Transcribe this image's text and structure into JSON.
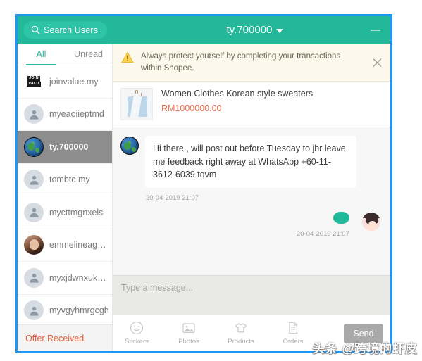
{
  "window": {
    "title": "ty.700000",
    "minimize_label": "minimize",
    "border_color": "#2196f3",
    "header_color": "#24b89a"
  },
  "search": {
    "label": "Search Users",
    "icon": "search-icon"
  },
  "sidebar": {
    "tabs": [
      {
        "label": "All",
        "active": true
      },
      {
        "label": "Unread",
        "active": false
      }
    ],
    "conversations": [
      {
        "name": "joinvalue.my",
        "avatar": "brand",
        "brand_line1": "JOIN",
        "brand_line2": "VALU",
        "selected": false
      },
      {
        "name": "myeaoiieptmd",
        "avatar": "person",
        "selected": false
      },
      {
        "name": "ty.700000",
        "avatar": "globe",
        "selected": true
      },
      {
        "name": "tombtc.my",
        "avatar": "person",
        "selected": false
      },
      {
        "name": "mycttmgnxels",
        "avatar": "person",
        "selected": false
      },
      {
        "name": "emmelineag…",
        "avatar": "photo-f",
        "selected": false
      },
      {
        "name": "myxjdwnxuk…",
        "avatar": "person",
        "selected": false
      },
      {
        "name": "myvgyhmrgcgh",
        "avatar": "person",
        "selected": false
      }
    ],
    "offer_status": "Offer Received",
    "offer_color": "#e8603c"
  },
  "notice": {
    "text": "Always protect yourself by completing your transactions within Shopee.",
    "icon": "warning-icon",
    "close_icon": "close-icon",
    "background": "#fdf8ec"
  },
  "product": {
    "title": "Women Clothes Korean style sweaters",
    "price": "RM1000000.00",
    "price_color": "#ef6b4b",
    "thumbnail": "blue-cardigan-photo"
  },
  "messages": [
    {
      "direction": "in",
      "avatar": "globe",
      "text": "Hi there , will post out before Tuesday to jhr leave me feedback right away at WhatsApp +60-11-3612-6039 tqvm",
      "time": "20-04-2019 21:07"
    },
    {
      "direction": "out",
      "avatar": "photo-anime",
      "text": "",
      "time": "20-04-2019 21:07"
    }
  ],
  "composer": {
    "placeholder": "Type a message..."
  },
  "toolbar": {
    "tools": [
      {
        "label": "Stickers",
        "icon": "smiley-icon"
      },
      {
        "label": "Photos",
        "icon": "image-icon"
      },
      {
        "label": "Products",
        "icon": "shirt-icon"
      },
      {
        "label": "Orders",
        "icon": "document-icon"
      }
    ],
    "send_label": "Send"
  },
  "watermark": {
    "text": "头条 @跨境的虾皮"
  }
}
